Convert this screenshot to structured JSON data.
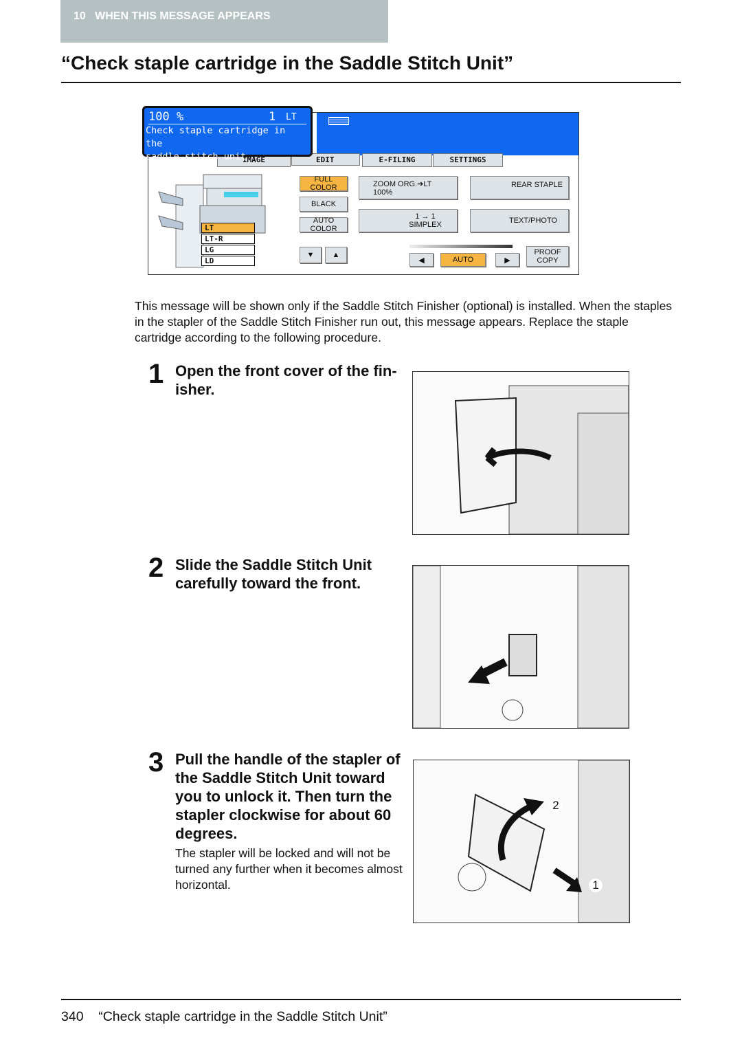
{
  "header": {
    "chapter": "10",
    "section": "WHEN THIS MESSAGE APPEARS"
  },
  "title": "“Check staple cartridge in the Saddle Stitch Unit”",
  "panel": {
    "zoom_display": "100  %",
    "copies": "1",
    "paper": "LT",
    "message_line1": "Check staple cartridge in the",
    "message_line2": "saddle stitch unit",
    "tabs": [
      "IMAGE",
      "EDIT",
      "E-FILING",
      "SETTINGS"
    ],
    "trays": [
      "LT",
      "LT-R",
      "LG",
      "LD"
    ],
    "color_buttons": [
      "FULL COLOR",
      "BLACK",
      "AUTO COLOR"
    ],
    "zoom_button": {
      "label": "ZOOM  ORG.➔LT",
      "value": "100%"
    },
    "duplex_button": {
      "label": "1 → 1",
      "mode": "SIMPLEX"
    },
    "staple_button": "REAR  STAPLE",
    "image_mode_button": "TEXT/PHOTO",
    "density_auto": "AUTO",
    "proof_copy": [
      "PROOF",
      "COPY"
    ],
    "accent": "#1168f0",
    "selected": "#f5b540"
  },
  "intro": "This message will be shown only if the Saddle Stitch Finisher (optional) is installed. When the staples in the stapler of the Saddle Stitch Finisher run out, this message appears. Replace the staple cartridge according to the following procedure.",
  "steps": [
    {
      "number": "1",
      "text": "Open the front cover of the fin-isher.",
      "note": ""
    },
    {
      "number": "2",
      "text": "Slide the Saddle Stitch Unit carefully toward the front.",
      "note": ""
    },
    {
      "number": "3",
      "text": "Pull the handle of the stapler of the Saddle Stitch Unit toward you to unlock it. Then turn the stapler clockwise for about 60 degrees.",
      "note": "The stapler will be locked and will not be turned any further when it becomes almost horizontal.",
      "callouts": [
        "2",
        "1"
      ]
    }
  ],
  "footer": {
    "page": "340",
    "text": "“Check staple cartridge in the Saddle Stitch Unit”"
  }
}
